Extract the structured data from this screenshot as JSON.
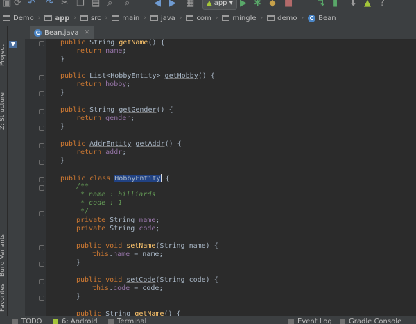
{
  "toolbar": {
    "run_config": "app",
    "icons": [
      "save-icon",
      "sync-icon",
      "undo-icon",
      "redo-icon",
      "cut-icon",
      "copy-icon",
      "paste-icon",
      "find-icon",
      "replace-icon",
      "back-icon",
      "forward-icon",
      "make-project-icon",
      "android-icon",
      "run-icon",
      "debug-icon",
      "profile-icon",
      "sync-gradle-icon",
      "avd-manager-icon",
      "sdk-manager-icon",
      "help-icon"
    ]
  },
  "breadcrumb": [
    "Demo",
    "app",
    "src",
    "main",
    "java",
    "com",
    "mingle",
    "demo",
    "Bean"
  ],
  "left_strip": {
    "project": "Project",
    "structure": "Z: Structure",
    "build_variants": "Build Variants",
    "favorites": "Favorites"
  },
  "tab": {
    "label": "Bean.java"
  },
  "code": {
    "l1_name": "getName",
    "l1_field": "name",
    "l2_type": "List<HobbyEntity>",
    "l2_name": "getHobby",
    "l2_field": "hobby",
    "l3_name": "getGender",
    "l3_field": "gender",
    "l4_type": "AddrEntity",
    "l4_name": "getAddr",
    "l4_field": "addr",
    "class_name_sel": "HobbyEntity",
    "doc1": "/**",
    "doc2": " * name : billiards",
    "doc3": " * code : 1",
    "doc4": " */",
    "f1": "name",
    "f2": "code",
    "m1_name": "setName",
    "m1_param": "(String name) {",
    "m1_field": "name",
    "m1_rhs": " = name;",
    "m2_name": "setCode",
    "m2_param": "(String code) {",
    "m2_field": "code",
    "m2_rhs": " = code;",
    "m3_name": "getName"
  },
  "bottom": {
    "todo": "TODO",
    "android": "6: Android",
    "terminal": "Terminal",
    "event_log": "Event Log",
    "gradle_console": "Gradle Console"
  },
  "colors": {
    "keyword": "#cc7832",
    "method": "#ffc66d",
    "field": "#9876aa",
    "comment": "#629755",
    "number": "#6897bb",
    "selection": "#214283"
  }
}
